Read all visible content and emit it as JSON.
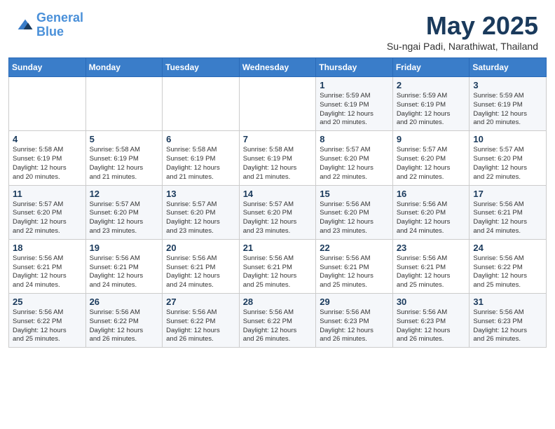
{
  "header": {
    "logo_line1": "General",
    "logo_line2": "Blue",
    "month_title": "May 2025",
    "subtitle": "Su-ngai Padi, Narathiwat, Thailand"
  },
  "days_of_week": [
    "Sunday",
    "Monday",
    "Tuesday",
    "Wednesday",
    "Thursday",
    "Friday",
    "Saturday"
  ],
  "weeks": [
    [
      {
        "num": "",
        "info": ""
      },
      {
        "num": "",
        "info": ""
      },
      {
        "num": "",
        "info": ""
      },
      {
        "num": "",
        "info": ""
      },
      {
        "num": "1",
        "info": "Sunrise: 5:59 AM\nSunset: 6:19 PM\nDaylight: 12 hours\nand 20 minutes."
      },
      {
        "num": "2",
        "info": "Sunrise: 5:59 AM\nSunset: 6:19 PM\nDaylight: 12 hours\nand 20 minutes."
      },
      {
        "num": "3",
        "info": "Sunrise: 5:59 AM\nSunset: 6:19 PM\nDaylight: 12 hours\nand 20 minutes."
      }
    ],
    [
      {
        "num": "4",
        "info": "Sunrise: 5:58 AM\nSunset: 6:19 PM\nDaylight: 12 hours\nand 20 minutes."
      },
      {
        "num": "5",
        "info": "Sunrise: 5:58 AM\nSunset: 6:19 PM\nDaylight: 12 hours\nand 21 minutes."
      },
      {
        "num": "6",
        "info": "Sunrise: 5:58 AM\nSunset: 6:19 PM\nDaylight: 12 hours\nand 21 minutes."
      },
      {
        "num": "7",
        "info": "Sunrise: 5:58 AM\nSunset: 6:19 PM\nDaylight: 12 hours\nand 21 minutes."
      },
      {
        "num": "8",
        "info": "Sunrise: 5:57 AM\nSunset: 6:20 PM\nDaylight: 12 hours\nand 22 minutes."
      },
      {
        "num": "9",
        "info": "Sunrise: 5:57 AM\nSunset: 6:20 PM\nDaylight: 12 hours\nand 22 minutes."
      },
      {
        "num": "10",
        "info": "Sunrise: 5:57 AM\nSunset: 6:20 PM\nDaylight: 12 hours\nand 22 minutes."
      }
    ],
    [
      {
        "num": "11",
        "info": "Sunrise: 5:57 AM\nSunset: 6:20 PM\nDaylight: 12 hours\nand 22 minutes."
      },
      {
        "num": "12",
        "info": "Sunrise: 5:57 AM\nSunset: 6:20 PM\nDaylight: 12 hours\nand 23 minutes."
      },
      {
        "num": "13",
        "info": "Sunrise: 5:57 AM\nSunset: 6:20 PM\nDaylight: 12 hours\nand 23 minutes."
      },
      {
        "num": "14",
        "info": "Sunrise: 5:57 AM\nSunset: 6:20 PM\nDaylight: 12 hours\nand 23 minutes."
      },
      {
        "num": "15",
        "info": "Sunrise: 5:56 AM\nSunset: 6:20 PM\nDaylight: 12 hours\nand 23 minutes."
      },
      {
        "num": "16",
        "info": "Sunrise: 5:56 AM\nSunset: 6:20 PM\nDaylight: 12 hours\nand 24 minutes."
      },
      {
        "num": "17",
        "info": "Sunrise: 5:56 AM\nSunset: 6:21 PM\nDaylight: 12 hours\nand 24 minutes."
      }
    ],
    [
      {
        "num": "18",
        "info": "Sunrise: 5:56 AM\nSunset: 6:21 PM\nDaylight: 12 hours\nand 24 minutes."
      },
      {
        "num": "19",
        "info": "Sunrise: 5:56 AM\nSunset: 6:21 PM\nDaylight: 12 hours\nand 24 minutes."
      },
      {
        "num": "20",
        "info": "Sunrise: 5:56 AM\nSunset: 6:21 PM\nDaylight: 12 hours\nand 24 minutes."
      },
      {
        "num": "21",
        "info": "Sunrise: 5:56 AM\nSunset: 6:21 PM\nDaylight: 12 hours\nand 25 minutes."
      },
      {
        "num": "22",
        "info": "Sunrise: 5:56 AM\nSunset: 6:21 PM\nDaylight: 12 hours\nand 25 minutes."
      },
      {
        "num": "23",
        "info": "Sunrise: 5:56 AM\nSunset: 6:21 PM\nDaylight: 12 hours\nand 25 minutes."
      },
      {
        "num": "24",
        "info": "Sunrise: 5:56 AM\nSunset: 6:22 PM\nDaylight: 12 hours\nand 25 minutes."
      }
    ],
    [
      {
        "num": "25",
        "info": "Sunrise: 5:56 AM\nSunset: 6:22 PM\nDaylight: 12 hours\nand 25 minutes."
      },
      {
        "num": "26",
        "info": "Sunrise: 5:56 AM\nSunset: 6:22 PM\nDaylight: 12 hours\nand 26 minutes."
      },
      {
        "num": "27",
        "info": "Sunrise: 5:56 AM\nSunset: 6:22 PM\nDaylight: 12 hours\nand 26 minutes."
      },
      {
        "num": "28",
        "info": "Sunrise: 5:56 AM\nSunset: 6:22 PM\nDaylight: 12 hours\nand 26 minutes."
      },
      {
        "num": "29",
        "info": "Sunrise: 5:56 AM\nSunset: 6:23 PM\nDaylight: 12 hours\nand 26 minutes."
      },
      {
        "num": "30",
        "info": "Sunrise: 5:56 AM\nSunset: 6:23 PM\nDaylight: 12 hours\nand 26 minutes."
      },
      {
        "num": "31",
        "info": "Sunrise: 5:56 AM\nSunset: 6:23 PM\nDaylight: 12 hours\nand 26 minutes."
      }
    ]
  ]
}
